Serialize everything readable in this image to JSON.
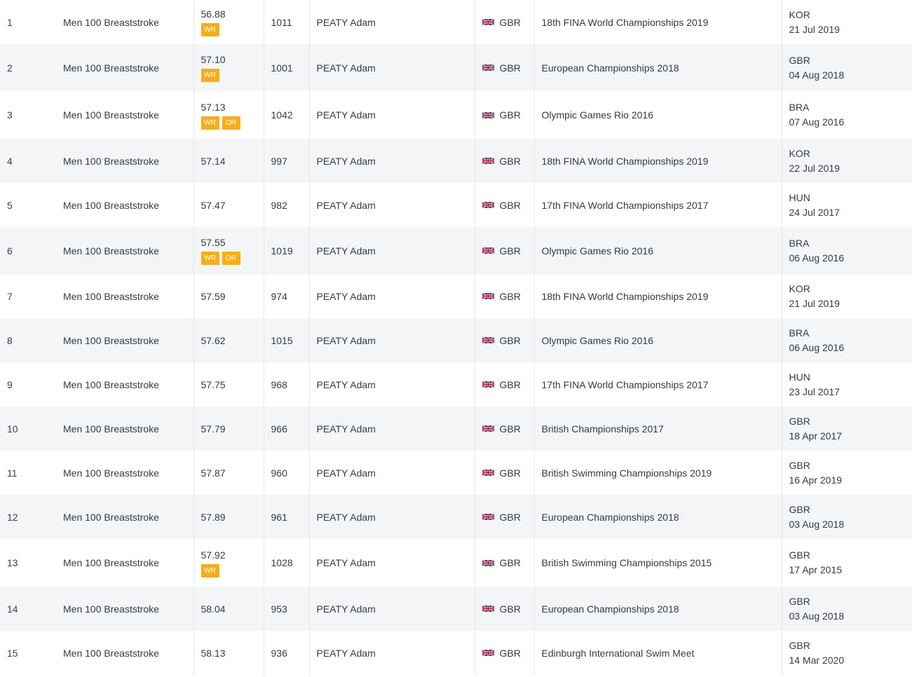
{
  "rankings": {
    "rows": [
      {
        "rank": "1",
        "event": "Men 100 Breaststroke",
        "time": "56.88",
        "badges": [
          "WR"
        ],
        "points": "1011",
        "athlete": "PEATY Adam",
        "country": "GBR",
        "meet": "18th FINA World Championships 2019",
        "location": "KOR",
        "date": "21 Jul 2019"
      },
      {
        "rank": "2",
        "event": "Men 100 Breaststroke",
        "time": "57.10",
        "badges": [
          "WR"
        ],
        "points": "1001",
        "athlete": "PEATY Adam",
        "country": "GBR",
        "meet": "European Championships 2018",
        "location": "GBR",
        "date": "04 Aug 2018"
      },
      {
        "rank": "3",
        "event": "Men 100 Breaststroke",
        "time": "57.13",
        "badges": [
          "WR",
          "OR"
        ],
        "points": "1042",
        "athlete": "PEATY Adam",
        "country": "GBR",
        "meet": "Olympic Games Rio 2016",
        "location": "BRA",
        "date": "07 Aug 2016"
      },
      {
        "rank": "4",
        "event": "Men 100 Breaststroke",
        "time": "57.14",
        "badges": [],
        "points": "997",
        "athlete": "PEATY Adam",
        "country": "GBR",
        "meet": "18th FINA World Championships 2019",
        "location": "KOR",
        "date": "22 Jul 2019"
      },
      {
        "rank": "5",
        "event": "Men 100 Breaststroke",
        "time": "57.47",
        "badges": [],
        "points": "982",
        "athlete": "PEATY Adam",
        "country": "GBR",
        "meet": "17th FINA World Championships 2017",
        "location": "HUN",
        "date": "24 Jul 2017"
      },
      {
        "rank": "6",
        "event": "Men 100 Breaststroke",
        "time": "57.55",
        "badges": [
          "WR",
          "OR"
        ],
        "points": "1019",
        "athlete": "PEATY Adam",
        "country": "GBR",
        "meet": "Olympic Games Rio 2016",
        "location": "BRA",
        "date": "06 Aug 2016"
      },
      {
        "rank": "7",
        "event": "Men 100 Breaststroke",
        "time": "57.59",
        "badges": [],
        "points": "974",
        "athlete": "PEATY Adam",
        "country": "GBR",
        "meet": "18th FINA World Championships 2019",
        "location": "KOR",
        "date": "21 Jul 2019"
      },
      {
        "rank": "8",
        "event": "Men 100 Breaststroke",
        "time": "57.62",
        "badges": [],
        "points": "1015",
        "athlete": "PEATY Adam",
        "country": "GBR",
        "meet": "Olympic Games Rio 2016",
        "location": "BRA",
        "date": "06 Aug 2016"
      },
      {
        "rank": "9",
        "event": "Men 100 Breaststroke",
        "time": "57.75",
        "badges": [],
        "points": "968",
        "athlete": "PEATY Adam",
        "country": "GBR",
        "meet": "17th FINA World Championships 2017",
        "location": "HUN",
        "date": "23 Jul 2017"
      },
      {
        "rank": "10",
        "event": "Men 100 Breaststroke",
        "time": "57.79",
        "badges": [],
        "points": "966",
        "athlete": "PEATY Adam",
        "country": "GBR",
        "meet": "British Championships 2017",
        "location": "GBR",
        "date": "18 Apr 2017"
      },
      {
        "rank": "11",
        "event": "Men 100 Breaststroke",
        "time": "57.87",
        "badges": [],
        "points": "960",
        "athlete": "PEATY Adam",
        "country": "GBR",
        "meet": "British Swimming Championships 2019",
        "location": "GBR",
        "date": "16 Apr 2019"
      },
      {
        "rank": "12",
        "event": "Men 100 Breaststroke",
        "time": "57.89",
        "badges": [],
        "points": "961",
        "athlete": "PEATY Adam",
        "country": "GBR",
        "meet": "European Championships 2018",
        "location": "GBR",
        "date": "03 Aug 2018"
      },
      {
        "rank": "13",
        "event": "Men 100 Breaststroke",
        "time": "57.92",
        "badges": [
          "WR"
        ],
        "points": "1028",
        "athlete": "PEATY Adam",
        "country": "GBR",
        "meet": "British Swimming Championships 2015",
        "location": "GBR",
        "date": "17 Apr 2015"
      },
      {
        "rank": "14",
        "event": "Men 100 Breaststroke",
        "time": "58.04",
        "badges": [],
        "points": "953",
        "athlete": "PEATY Adam",
        "country": "GBR",
        "meet": "European Championships 2018",
        "location": "GBR",
        "date": "03 Aug 2018"
      },
      {
        "rank": "15",
        "event": "Men 100 Breaststroke",
        "time": "58.13",
        "badges": [],
        "points": "936",
        "athlete": "PEATY Adam",
        "country": "GBR",
        "meet": "Edinburgh International Swim Meet",
        "location": "GBR",
        "date": "14 Mar 2020"
      }
    ]
  },
  "icons": {
    "country_flag": "uk-flag-icon"
  },
  "colors": {
    "badge": "#f5ae1b",
    "row_alt": "#f4f5f7",
    "text": "#333a44"
  }
}
